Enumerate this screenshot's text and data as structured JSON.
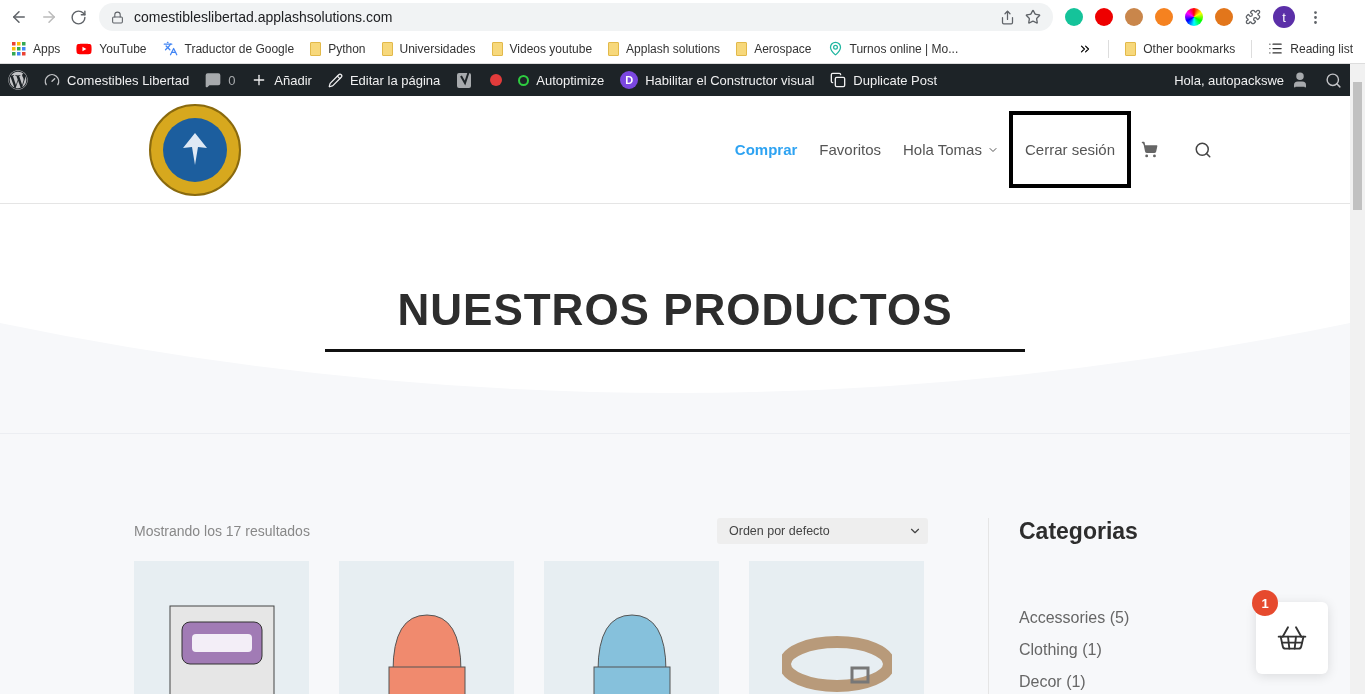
{
  "browser": {
    "url": "comestibleslibertad.applashsolutions.com",
    "profile_initial": "t"
  },
  "bookmarks": [
    {
      "label": "Apps",
      "kind": "apps"
    },
    {
      "label": "YouTube",
      "kind": "youtube"
    },
    {
      "label": "Traductor de Google",
      "kind": "translate"
    },
    {
      "label": "Python",
      "kind": "folder"
    },
    {
      "label": "Universidades",
      "kind": "folder"
    },
    {
      "label": "Videos youtube",
      "kind": "folder"
    },
    {
      "label": "Applash solutions",
      "kind": "folder"
    },
    {
      "label": "Aerospace",
      "kind": "folder"
    },
    {
      "label": "Turnos online | Mo...",
      "kind": "site"
    }
  ],
  "other_bookmarks": "Other bookmarks",
  "reading_list": "Reading list",
  "admin_bar": {
    "items": [
      {
        "kind": "wp"
      },
      {
        "kind": "site",
        "label": "Comestibles Libertad"
      },
      {
        "kind": "comments",
        "label": "0"
      },
      {
        "kind": "add",
        "label": "Añadir"
      },
      {
        "kind": "edit",
        "label": "Editar la página"
      },
      {
        "kind": "yoast"
      },
      {
        "kind": "dot"
      },
      {
        "kind": "autoptimize",
        "label": "Autoptimize"
      },
      {
        "kind": "divi",
        "icon_text": "D",
        "label": "Habilitar el Constructor visual"
      },
      {
        "kind": "duplicate",
        "label": "Duplicate Post"
      }
    ],
    "greeting": "Hola, autopackswe"
  },
  "nav": [
    {
      "label": "Comprar",
      "selected": true,
      "dropdown": false,
      "highlighted": false
    },
    {
      "label": "Favoritos",
      "selected": false,
      "dropdown": false,
      "highlighted": false
    },
    {
      "label": "Hola Tomas",
      "selected": false,
      "dropdown": true,
      "highlighted": false
    },
    {
      "label": "Cerrar sesión",
      "selected": false,
      "dropdown": false,
      "highlighted": true
    }
  ],
  "hero": {
    "title": "NUESTROS PRODUCTOS"
  },
  "shop": {
    "result_count": "Mostrando los 17 resultados",
    "sort": "Orden por defecto",
    "products": [
      {
        "kind": "album"
      },
      {
        "kind": "beanie",
        "color": "#f08a6e"
      },
      {
        "kind": "beanie",
        "color": "#86c1dc"
      },
      {
        "kind": "belt"
      }
    ]
  },
  "sidebar": {
    "title": "Categorias",
    "categories": [
      "Accessories (5)",
      "Clothing (1)",
      "Decor (1)"
    ]
  },
  "cart": {
    "count": "1"
  }
}
